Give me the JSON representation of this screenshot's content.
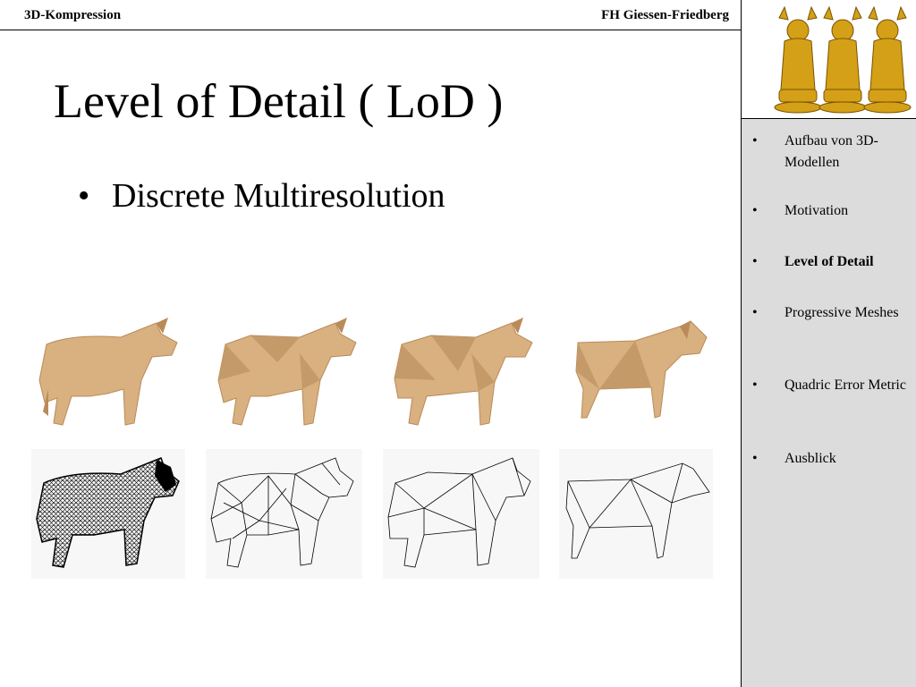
{
  "header": {
    "left": "3D-Kompression",
    "right": "FH Giessen-Friedberg"
  },
  "title": "Level of Detail ( LoD )",
  "bullets": [
    "Discrete Multiresolution"
  ],
  "sidebar": {
    "items": [
      {
        "label": "Aufbau von 3D-Modellen",
        "active": false
      },
      {
        "label": "Motivation",
        "active": false
      },
      {
        "label": "Level of Detail",
        "active": true
      },
      {
        "label": "Progressive Meshes",
        "active": false
      },
      {
        "label": "Quadric Error Metric",
        "active": false
      },
      {
        "label": "Ausblick",
        "active": false
      }
    ]
  },
  "colors": {
    "cow_fill": "#d9b07f",
    "cow_shadow": "#b88b59",
    "buddha": "#d4a017",
    "sidebar_bg": "#dcdcdc"
  }
}
